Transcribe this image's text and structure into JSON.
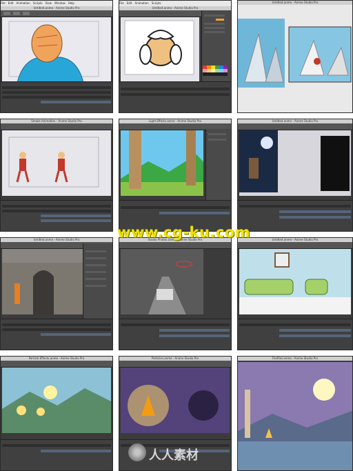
{
  "menu": {
    "items": [
      "File",
      "Edit",
      "Animation",
      "Scripts",
      "View",
      "Window",
      "Help"
    ]
  },
  "tiles": [
    {
      "title": "Untitled.anme - Anime Studio Pro"
    },
    {
      "title": "Untitled.anme - Anime Studio Pro"
    },
    {
      "title": "Untitled.anme - Anime Studio Pro"
    },
    {
      "title": "Smoke Animation - Anime Studio Pro"
    },
    {
      "title": "Light Effects.anme - Anime Studio Pro"
    },
    {
      "title": "Untitled.anme - Anime Studio Pro"
    },
    {
      "title": "Untitled.anme - Anime Studio Pro"
    },
    {
      "title": "Studio Photos.anme - Anime Studio Pro"
    },
    {
      "title": "Untitled.anme - Anime Studio Pro"
    },
    {
      "title": "Particle Effects.anme - Anime Studio Pro"
    },
    {
      "title": "Particles.anme - Anime Studio Pro"
    },
    {
      "title": "Fireflies.anme - Anime Studio Pro"
    }
  ],
  "watermark": "www.cg-ku.com",
  "logo_text": "人人素材",
  "colors": {
    "watermark": "#f0e200",
    "ui_dark": "#3b3b3b",
    "timeline_track": "#55647a"
  }
}
